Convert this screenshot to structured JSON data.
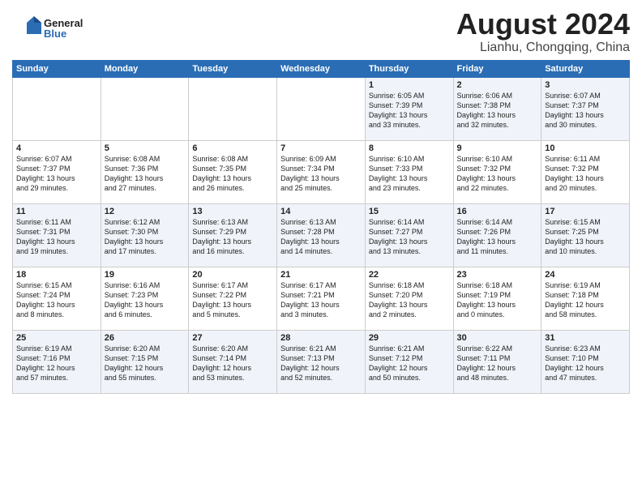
{
  "header": {
    "logo_general": "General",
    "logo_blue": "Blue",
    "month_title": "August 2024",
    "location": "Lianhu, Chongqing, China"
  },
  "weekdays": [
    "Sunday",
    "Monday",
    "Tuesday",
    "Wednesday",
    "Thursday",
    "Friday",
    "Saturday"
  ],
  "weeks": [
    [
      {
        "day": "",
        "info": ""
      },
      {
        "day": "",
        "info": ""
      },
      {
        "day": "",
        "info": ""
      },
      {
        "day": "",
        "info": ""
      },
      {
        "day": "1",
        "info": "Sunrise: 6:05 AM\nSunset: 7:39 PM\nDaylight: 13 hours\nand 33 minutes."
      },
      {
        "day": "2",
        "info": "Sunrise: 6:06 AM\nSunset: 7:38 PM\nDaylight: 13 hours\nand 32 minutes."
      },
      {
        "day": "3",
        "info": "Sunrise: 6:07 AM\nSunset: 7:37 PM\nDaylight: 13 hours\nand 30 minutes."
      }
    ],
    [
      {
        "day": "4",
        "info": "Sunrise: 6:07 AM\nSunset: 7:37 PM\nDaylight: 13 hours\nand 29 minutes."
      },
      {
        "day": "5",
        "info": "Sunrise: 6:08 AM\nSunset: 7:36 PM\nDaylight: 13 hours\nand 27 minutes."
      },
      {
        "day": "6",
        "info": "Sunrise: 6:08 AM\nSunset: 7:35 PM\nDaylight: 13 hours\nand 26 minutes."
      },
      {
        "day": "7",
        "info": "Sunrise: 6:09 AM\nSunset: 7:34 PM\nDaylight: 13 hours\nand 25 minutes."
      },
      {
        "day": "8",
        "info": "Sunrise: 6:10 AM\nSunset: 7:33 PM\nDaylight: 13 hours\nand 23 minutes."
      },
      {
        "day": "9",
        "info": "Sunrise: 6:10 AM\nSunset: 7:32 PM\nDaylight: 13 hours\nand 22 minutes."
      },
      {
        "day": "10",
        "info": "Sunrise: 6:11 AM\nSunset: 7:32 PM\nDaylight: 13 hours\nand 20 minutes."
      }
    ],
    [
      {
        "day": "11",
        "info": "Sunrise: 6:11 AM\nSunset: 7:31 PM\nDaylight: 13 hours\nand 19 minutes."
      },
      {
        "day": "12",
        "info": "Sunrise: 6:12 AM\nSunset: 7:30 PM\nDaylight: 13 hours\nand 17 minutes."
      },
      {
        "day": "13",
        "info": "Sunrise: 6:13 AM\nSunset: 7:29 PM\nDaylight: 13 hours\nand 16 minutes."
      },
      {
        "day": "14",
        "info": "Sunrise: 6:13 AM\nSunset: 7:28 PM\nDaylight: 13 hours\nand 14 minutes."
      },
      {
        "day": "15",
        "info": "Sunrise: 6:14 AM\nSunset: 7:27 PM\nDaylight: 13 hours\nand 13 minutes."
      },
      {
        "day": "16",
        "info": "Sunrise: 6:14 AM\nSunset: 7:26 PM\nDaylight: 13 hours\nand 11 minutes."
      },
      {
        "day": "17",
        "info": "Sunrise: 6:15 AM\nSunset: 7:25 PM\nDaylight: 13 hours\nand 10 minutes."
      }
    ],
    [
      {
        "day": "18",
        "info": "Sunrise: 6:15 AM\nSunset: 7:24 PM\nDaylight: 13 hours\nand 8 minutes."
      },
      {
        "day": "19",
        "info": "Sunrise: 6:16 AM\nSunset: 7:23 PM\nDaylight: 13 hours\nand 6 minutes."
      },
      {
        "day": "20",
        "info": "Sunrise: 6:17 AM\nSunset: 7:22 PM\nDaylight: 13 hours\nand 5 minutes."
      },
      {
        "day": "21",
        "info": "Sunrise: 6:17 AM\nSunset: 7:21 PM\nDaylight: 13 hours\nand 3 minutes."
      },
      {
        "day": "22",
        "info": "Sunrise: 6:18 AM\nSunset: 7:20 PM\nDaylight: 13 hours\nand 2 minutes."
      },
      {
        "day": "23",
        "info": "Sunrise: 6:18 AM\nSunset: 7:19 PM\nDaylight: 13 hours\nand 0 minutes."
      },
      {
        "day": "24",
        "info": "Sunrise: 6:19 AM\nSunset: 7:18 PM\nDaylight: 12 hours\nand 58 minutes."
      }
    ],
    [
      {
        "day": "25",
        "info": "Sunrise: 6:19 AM\nSunset: 7:16 PM\nDaylight: 12 hours\nand 57 minutes."
      },
      {
        "day": "26",
        "info": "Sunrise: 6:20 AM\nSunset: 7:15 PM\nDaylight: 12 hours\nand 55 minutes."
      },
      {
        "day": "27",
        "info": "Sunrise: 6:20 AM\nSunset: 7:14 PM\nDaylight: 12 hours\nand 53 minutes."
      },
      {
        "day": "28",
        "info": "Sunrise: 6:21 AM\nSunset: 7:13 PM\nDaylight: 12 hours\nand 52 minutes."
      },
      {
        "day": "29",
        "info": "Sunrise: 6:21 AM\nSunset: 7:12 PM\nDaylight: 12 hours\nand 50 minutes."
      },
      {
        "day": "30",
        "info": "Sunrise: 6:22 AM\nSunset: 7:11 PM\nDaylight: 12 hours\nand 48 minutes."
      },
      {
        "day": "31",
        "info": "Sunrise: 6:23 AM\nSunset: 7:10 PM\nDaylight: 12 hours\nand 47 minutes."
      }
    ]
  ]
}
